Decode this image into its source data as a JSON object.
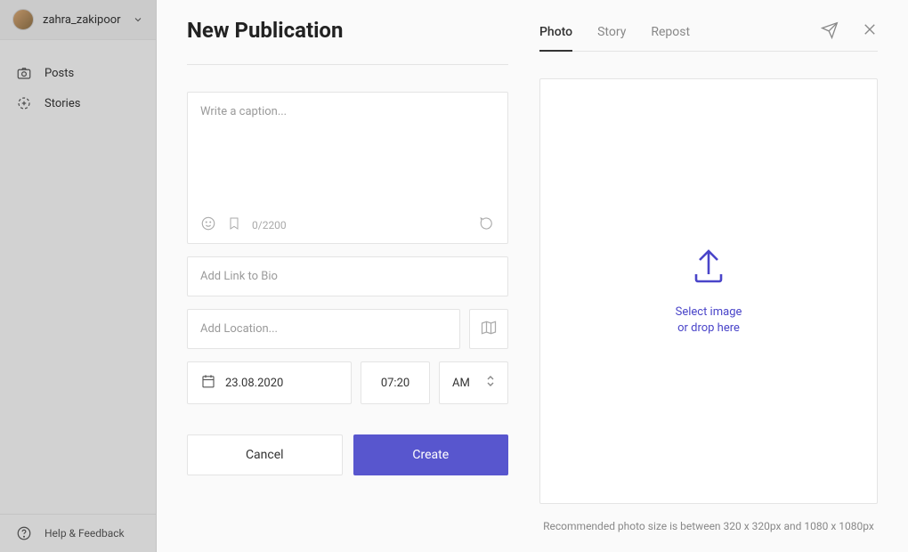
{
  "sidebar": {
    "account_name": "zahra_zakipoor",
    "nav": {
      "posts": "Posts",
      "stories": "Stories"
    },
    "help": "Help & Feedback"
  },
  "modal": {
    "title": "New Publication",
    "tabs": {
      "photo": "Photo",
      "story": "Story",
      "repost": "Repost"
    },
    "caption": {
      "placeholder": "Write a caption...",
      "counter": "0/2200"
    },
    "link_bio_placeholder": "Add Link to Bio",
    "location_placeholder": "Add Location...",
    "date": "23.08.2020",
    "time": "07:20",
    "ampm": "AM",
    "cancel": "Cancel",
    "create": "Create",
    "upload": {
      "line1": "Select image",
      "line2": "or drop here"
    },
    "recommendation": "Recommended photo size is between 320 x 320px and 1080 x 1080px"
  }
}
